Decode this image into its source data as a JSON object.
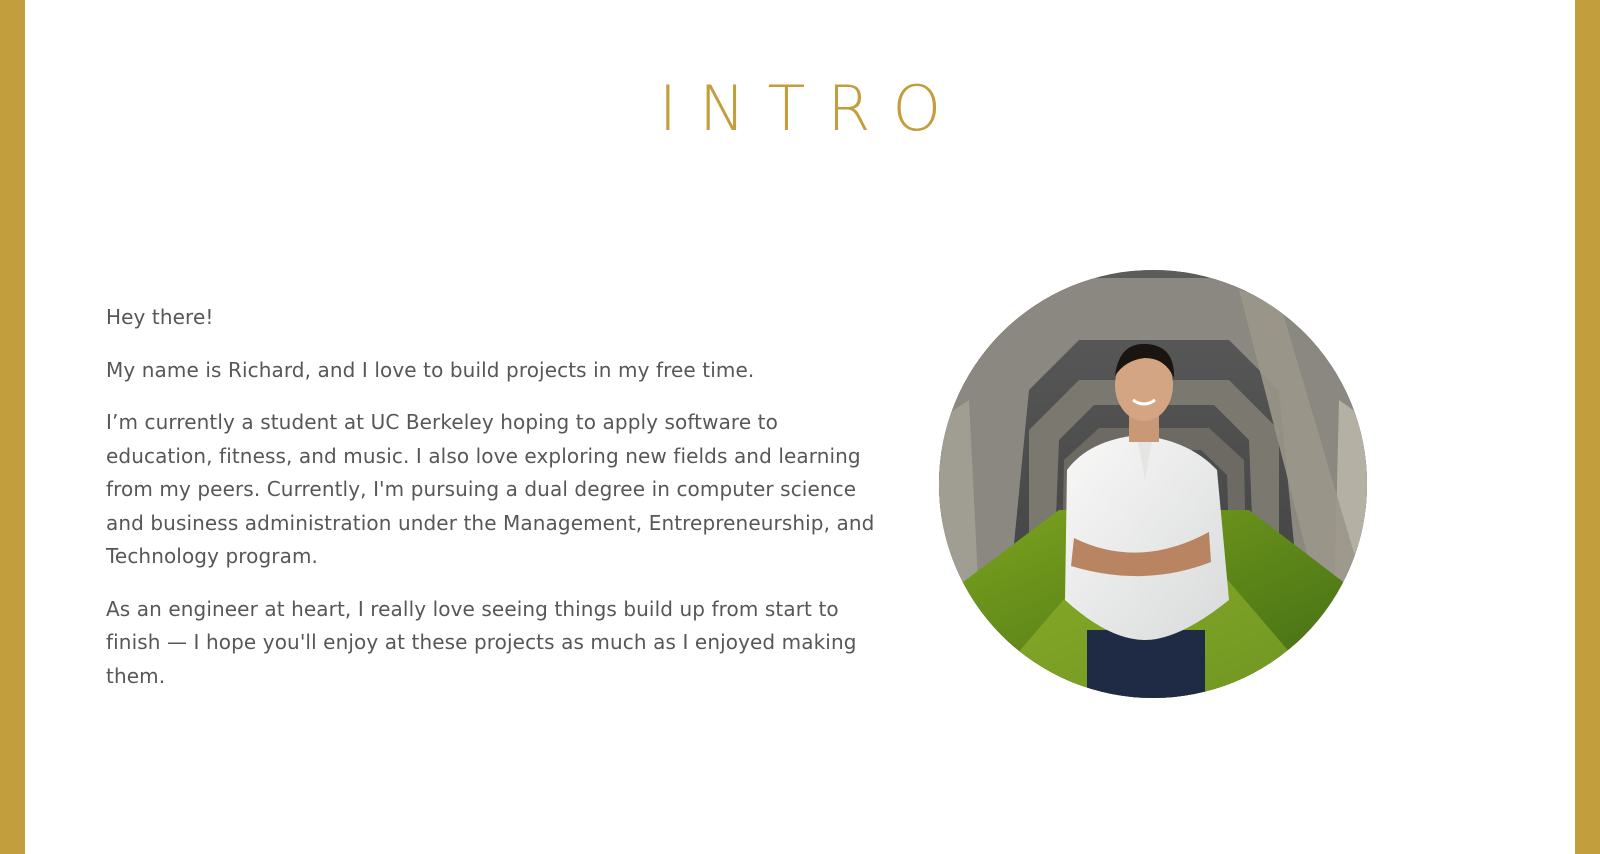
{
  "section": {
    "title": "INTRO"
  },
  "intro": {
    "paragraphs": [
      "Hey there!",
      "My name is Richard, and I love to build projects in my free time.",
      "I’m currently a student at UC Berkeley hoping to apply software to education, fitness, and music. I also love exploring new fields and learning from my peers. Currently, I'm pursuing a dual degree in computer science and business administration under the Management, Entrepreneurship, and Technology program.",
      "As an engineer at heart, I really love seeing things build up from start to finish — I hope you'll enjoy at these projects as much as I enjoyed making them."
    ]
  },
  "theme": {
    "accent": "#c29f3c",
    "text": "#575757",
    "background": "#ffffff"
  },
  "portrait": {
    "icon": "profile-photo"
  }
}
